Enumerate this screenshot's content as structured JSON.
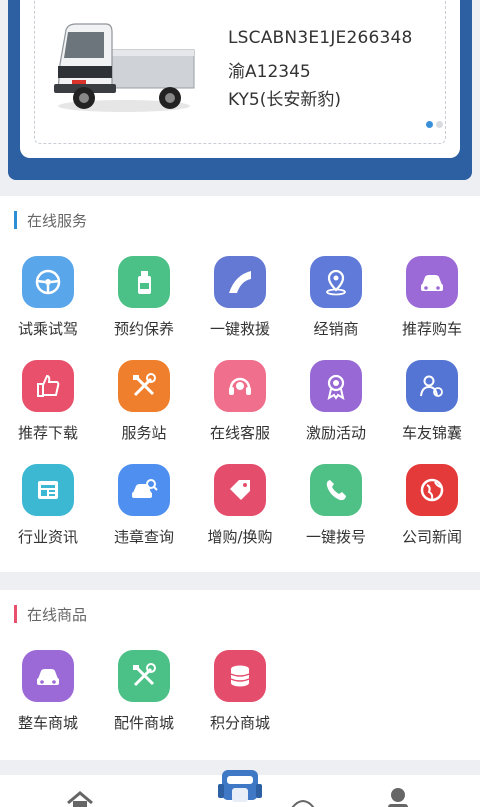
{
  "vehicle": {
    "vin": "LSCABN3E1JE266348",
    "plate": "渝A12345",
    "model": "KY5(长安新豹)",
    "carousel": {
      "total": 2,
      "active": 1
    }
  },
  "online_services": {
    "title": "在线服务",
    "accent": "#2c8fd6",
    "items": [
      {
        "label": "试乘试驾",
        "icon": "steering-wheel-icon",
        "color": "#5aa6ea"
      },
      {
        "label": "预约保养",
        "icon": "oil-bottle-icon",
        "color": "#4cc187"
      },
      {
        "label": "一键救援",
        "icon": "road-icon",
        "color": "#6479d4"
      },
      {
        "label": "经销商",
        "icon": "location-pin-icon",
        "color": "#5f7ad8"
      },
      {
        "label": "推荐购车",
        "icon": "car-icon",
        "color": "#9c6ad6"
      },
      {
        "label": "推荐下载",
        "icon": "thumbs-up-icon",
        "color": "#e9506b"
      },
      {
        "label": "服务站",
        "icon": "tools-icon",
        "color": "#ef7f2d"
      },
      {
        "label": "在线客服",
        "icon": "headset-icon",
        "color": "#ef6f8c"
      },
      {
        "label": "激励活动",
        "icon": "award-icon",
        "color": "#9868d4"
      },
      {
        "label": "车友锦囊",
        "icon": "community-icon",
        "color": "#5475d4"
      },
      {
        "label": "行业资讯",
        "icon": "news-icon",
        "color": "#3cb8d3"
      },
      {
        "label": "违章查询",
        "icon": "car-search-icon",
        "color": "#4f8ff0"
      },
      {
        "label": "增购/换购",
        "icon": "tag-icon",
        "color": "#e54d6d"
      },
      {
        "label": "一键拨号",
        "icon": "phone-icon",
        "color": "#4fc187"
      },
      {
        "label": "公司新闻",
        "icon": "globe-icon",
        "color": "#e53a3a"
      }
    ]
  },
  "online_goods": {
    "title": "在线商品",
    "accent": "#e8506c",
    "items": [
      {
        "label": "整车商城",
        "icon": "car-icon",
        "color": "#9c6ad6"
      },
      {
        "label": "配件商城",
        "icon": "tools-icon",
        "color": "#4cc187"
      },
      {
        "label": "积分商城",
        "icon": "coins-icon",
        "color": "#e54d6d"
      }
    ]
  },
  "bottom_nav": {
    "items": [
      "home-icon",
      "robot-icon",
      "message-icon",
      "user-icon"
    ]
  }
}
